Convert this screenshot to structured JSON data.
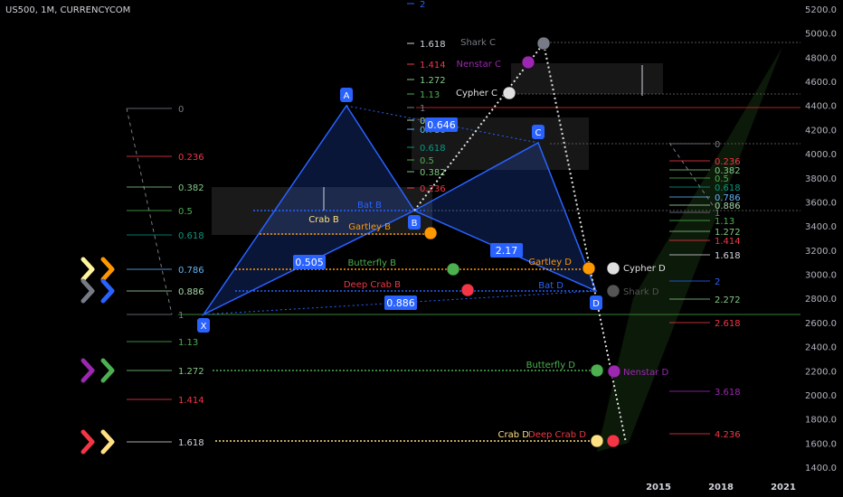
{
  "chart_data": {
    "type": "line",
    "symbol": "US500, 1M, CURRENCYCOM",
    "yaxis": {
      "ticks": [
        "5200.0",
        "5000.0",
        "4800.0",
        "4600.0",
        "4400.0",
        "4200.0",
        "4000.0",
        "3800.0",
        "3600.0",
        "3400.0",
        "3200.0",
        "3000.0",
        "2800.0",
        "2600.0",
        "2400.0",
        "2200.0",
        "2000.0",
        "1800.0",
        "1600.0",
        "1400.0"
      ],
      "ylim": [
        1400,
        5200
      ]
    },
    "xaxis": {
      "ticks": [
        "2015",
        "2018",
        "2021"
      ]
    },
    "pivots": [
      {
        "label": "X",
        "value": 2650
      },
      {
        "label": "A",
        "value": 4380
      },
      {
        "label": "B",
        "value": 3520
      },
      {
        "label": "C",
        "value": 4070
      },
      {
        "label": "D",
        "value": 2720
      }
    ],
    "ratio_labels": [
      "0.646",
      "0.505",
      "0.886",
      "2.17"
    ],
    "left_levels": [
      {
        "label": "0",
        "color": "#787b86"
      },
      {
        "label": "0.236",
        "color": "#f23645"
      },
      {
        "label": "0.382",
        "color": "#81c784"
      },
      {
        "label": "0.5",
        "color": "#4caf50"
      },
      {
        "label": "0.618",
        "color": "#089981"
      },
      {
        "label": "0.786",
        "color": "#64b5f6"
      },
      {
        "label": "0.886",
        "color": "#a5d6a7"
      },
      {
        "label": "1",
        "color": "#787b86"
      },
      {
        "label": "1.13",
        "color": "#4caf50"
      },
      {
        "label": "1.272",
        "color": "#81c784"
      },
      {
        "label": "1.414",
        "color": "#f23645"
      },
      {
        "label": "1.618",
        "color": "#d1d4dc"
      }
    ],
    "mid_levels": [
      {
        "label": "2",
        "color": "#2962ff"
      },
      {
        "label": "1.618",
        "color": "#d1d4dc"
      },
      {
        "label": "1.414",
        "color": "#f23645"
      },
      {
        "label": "1.272",
        "color": "#81c784"
      },
      {
        "label": "1.13",
        "color": "#4caf50"
      },
      {
        "label": "1",
        "color": "#787b86"
      },
      {
        "label": "0.886",
        "color": "#a5d6a7"
      },
      {
        "label": "0.786",
        "color": "#64b5f6"
      },
      {
        "label": "0.618",
        "color": "#089981"
      },
      {
        "label": "0.5",
        "color": "#4caf50"
      },
      {
        "label": "0.382",
        "color": "#81c784"
      },
      {
        "label": "0.236",
        "color": "#f23645"
      }
    ],
    "right_levels": [
      {
        "label": "0",
        "color": "#787b86"
      },
      {
        "label": "0.236",
        "color": "#f23645"
      },
      {
        "label": "0.382",
        "color": "#81c784"
      },
      {
        "label": "0.5",
        "color": "#4caf50"
      },
      {
        "label": "0.618",
        "color": "#089981"
      },
      {
        "label": "0.786",
        "color": "#64b5f6"
      },
      {
        "label": "0.886",
        "color": "#a5d6a7"
      },
      {
        "label": "1",
        "color": "#787b86"
      },
      {
        "label": "1.13",
        "color": "#4caf50"
      },
      {
        "label": "1.272",
        "color": "#81c784"
      },
      {
        "label": "1.414",
        "color": "#f23645"
      },
      {
        "label": "1.618",
        "color": "#d1d4dc"
      },
      {
        "label": "2",
        "color": "#2962ff"
      },
      {
        "label": "2.272",
        "color": "#81c784"
      },
      {
        "label": "2.618",
        "color": "#f23645"
      },
      {
        "label": "3.618",
        "color": "#9c27b0"
      },
      {
        "label": "4.236",
        "color": "#f23645"
      }
    ],
    "pattern_points": [
      {
        "label": "Crab B",
        "color": "#ffe082"
      },
      {
        "label": "Gartley B",
        "color": "#ff9800"
      },
      {
        "label": "Bat B",
        "color": "#2962ff"
      },
      {
        "label": "Butterfly B",
        "color": "#4caf50"
      },
      {
        "label": "Deep Crab B",
        "color": "#f23645"
      },
      {
        "label": "Gartley D",
        "color": "#ff9800"
      },
      {
        "label": "Cypher D",
        "color": "#e0e0e0"
      },
      {
        "label": "Bat D",
        "color": "#2962ff"
      },
      {
        "label": "Shark D",
        "color": "#555555"
      },
      {
        "label": "Butterfly D",
        "color": "#4caf50"
      },
      {
        "label": "Nenstar D",
        "color": "#9c27b0"
      },
      {
        "label": "Crab D",
        "color": "#ffe082"
      },
      {
        "label": "Deep Crab D",
        "color": "#f23645"
      },
      {
        "label": "Shark C",
        "color": "#787b86"
      },
      {
        "label": "Nenstar C",
        "color": "#9c27b0"
      },
      {
        "label": "Cypher C",
        "color": "#e0e0e0"
      }
    ],
    "arrow_icons": [
      {
        "name": "chevron-right-icon",
        "colors": [
          "#fff59d",
          "#ff9800"
        ]
      },
      {
        "name": "chevron-right-icon",
        "colors": [
          "#787b86",
          "#2962ff"
        ]
      },
      {
        "name": "chevron-right-icon",
        "colors": [
          "#9c27b0",
          "#4caf50"
        ]
      },
      {
        "name": "chevron-right-icon",
        "colors": [
          "#f23645",
          "#ffe082"
        ]
      }
    ],
    "colors": {
      "pattern": "#2962ff",
      "fill": "rgba(41,98,255,0.22)",
      "background": "#000000"
    }
  }
}
